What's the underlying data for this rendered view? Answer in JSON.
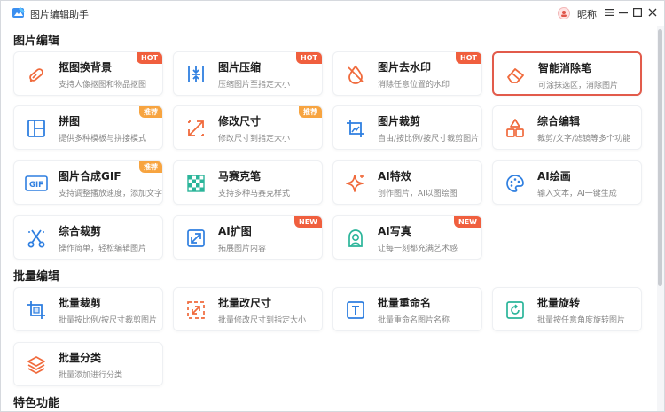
{
  "app": {
    "title": "图片编辑助手",
    "user_name": "昵称"
  },
  "colors": {
    "accent": "#2f80ed",
    "hot": "#f05f3e",
    "recommend": "#f7a440",
    "selected_border": "#e25b4b",
    "icon_blue": "#2f7fe0",
    "icon_orange": "#f06a3c"
  },
  "sections": {
    "image_edit": {
      "title": "图片编辑",
      "cards": [
        {
          "title": "抠图换背景",
          "desc": "支持人像抠图和物品抠图",
          "badge": "HOT",
          "icon": "cutout-icon"
        },
        {
          "title": "图片压缩",
          "desc": "压缩图片至指定大小",
          "badge": "HOT",
          "icon": "compress-icon"
        },
        {
          "title": "图片去水印",
          "desc": "消除任意位置的水印",
          "badge": "HOT",
          "icon": "remove-watermark-icon"
        },
        {
          "title": "智能消除笔",
          "desc": "可涂抹选区，消除图片",
          "badge": "",
          "icon": "eraser-icon",
          "selected": true
        },
        {
          "title": "拼图",
          "desc": "提供多种模板与拼接模式",
          "badge": "推荐",
          "icon": "collage-icon"
        },
        {
          "title": "修改尺寸",
          "desc": "修改尺寸到指定大小",
          "badge": "推荐",
          "icon": "resize-icon"
        },
        {
          "title": "图片裁剪",
          "desc": "自由/按比例/按尺寸裁剪图片",
          "badge": "",
          "icon": "crop-icon"
        },
        {
          "title": "综合编辑",
          "desc": "裁剪/文字/滤镜等多个功能",
          "badge": "",
          "icon": "shapes-icon"
        },
        {
          "title": "图片合成GIF",
          "desc": "支持调整播放速度，添加文字",
          "badge": "推荐",
          "icon": "gif-icon"
        },
        {
          "title": "马赛克笔",
          "desc": "支持多种马赛克样式",
          "badge": "",
          "icon": "mosaic-icon"
        },
        {
          "title": "AI特效",
          "desc": "创作图片，AI以图绘图",
          "badge": "",
          "icon": "sparkle-icon"
        },
        {
          "title": "AI绘画",
          "desc": "输入文本，AI一键生成",
          "badge": "",
          "icon": "palette-icon"
        },
        {
          "title": "综合裁剪",
          "desc": "操作简单，轻松编辑图片",
          "badge": "",
          "icon": "scissors-icon"
        },
        {
          "title": "AI扩图",
          "desc": "拓展图片内容",
          "badge": "NEW",
          "icon": "expand-icon"
        },
        {
          "title": "AI写真",
          "desc": "让每一刻都充满艺术感",
          "badge": "NEW",
          "icon": "portrait-icon"
        }
      ]
    },
    "batch_edit": {
      "title": "批量编辑",
      "cards": [
        {
          "title": "批量裁剪",
          "desc": "批量按比例/按尺寸裁剪图片",
          "badge": "",
          "icon": "batch-crop-icon"
        },
        {
          "title": "批量改尺寸",
          "desc": "批量修改尺寸到指定大小",
          "badge": "",
          "icon": "batch-resize-icon"
        },
        {
          "title": "批量重命名",
          "desc": "批量重命名图片名称",
          "badge": "",
          "icon": "rename-icon"
        },
        {
          "title": "批量旋转",
          "desc": "批量按任意角度旋转图片",
          "badge": "",
          "icon": "rotate-icon"
        },
        {
          "title": "批量分类",
          "desc": "批量添加进行分类",
          "badge": "",
          "icon": "layers-icon"
        }
      ]
    },
    "special": {
      "title": "特色功能"
    }
  }
}
